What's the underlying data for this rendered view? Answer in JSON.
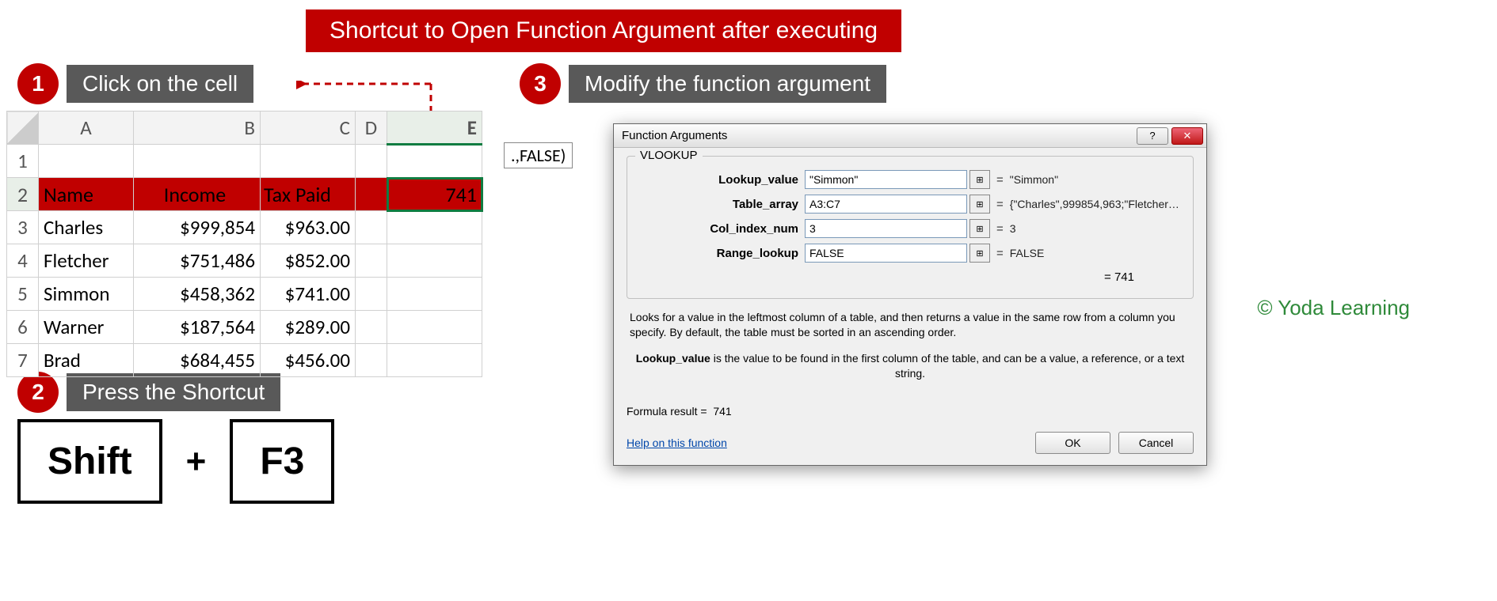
{
  "title": "Shortcut to Open Function Argument after executing",
  "steps": {
    "s1": {
      "num": "1",
      "label": "Click on the cell"
    },
    "s2": {
      "num": "2",
      "label": "Press the Shortcut"
    },
    "s3": {
      "num": "3",
      "label": "Modify the function argument"
    }
  },
  "sheet": {
    "cols": [
      "A",
      "B",
      "C",
      "D",
      "E"
    ],
    "rows": [
      "1",
      "2",
      "3",
      "4",
      "5",
      "6",
      "7"
    ],
    "header": {
      "a": "Name",
      "b": "Income",
      "c": "Tax Paid"
    },
    "data": [
      {
        "a": "Charles",
        "b": "$999,854",
        "c": "$963.00"
      },
      {
        "a": "Fletcher",
        "b": "$751,486",
        "c": "$852.00"
      },
      {
        "a": "Simmon",
        "b": "$458,362",
        "c": "$741.00"
      },
      {
        "a": "Warner",
        "b": "$187,564",
        "c": "$289.00"
      },
      {
        "a": "Brad",
        "b": "$684,455",
        "c": "$456.00"
      }
    ],
    "e2": "741"
  },
  "formula_tip": ".,FALSE)",
  "keys": {
    "k1": "Shift",
    "plus": "+",
    "k2": "F3"
  },
  "dialog": {
    "title": "Function Arguments",
    "fn": "VLOOKUP",
    "args": {
      "lookup_value": {
        "label": "Lookup_value",
        "val": "\"Simmon\"",
        "res": "\"Simmon\""
      },
      "table_array": {
        "label": "Table_array",
        "val": "A3:C7",
        "res": "{\"Charles\",999854,963;\"Fletcher\",751..."
      },
      "col_index_num": {
        "label": "Col_index_num",
        "val": "3",
        "res": "3"
      },
      "range_lookup": {
        "label": "Range_lookup",
        "val": "FALSE",
        "res": "FALSE"
      }
    },
    "calc_result": "= 741",
    "desc_main": "Looks for a value in the leftmost column of a table, and then returns a value in the same row from a column you specify. By default, the table must be sorted in an ascending order.",
    "desc_arg_label": "Lookup_value",
    "desc_arg_text": " is the value to be found in the first column of the table, and can be a value, a reference, or a text string.",
    "formula_result_label": "Formula result =",
    "formula_result_value": "741",
    "help": "Help on this function",
    "ok": "OK",
    "cancel": "Cancel"
  },
  "watermark": "© Yoda Learning"
}
